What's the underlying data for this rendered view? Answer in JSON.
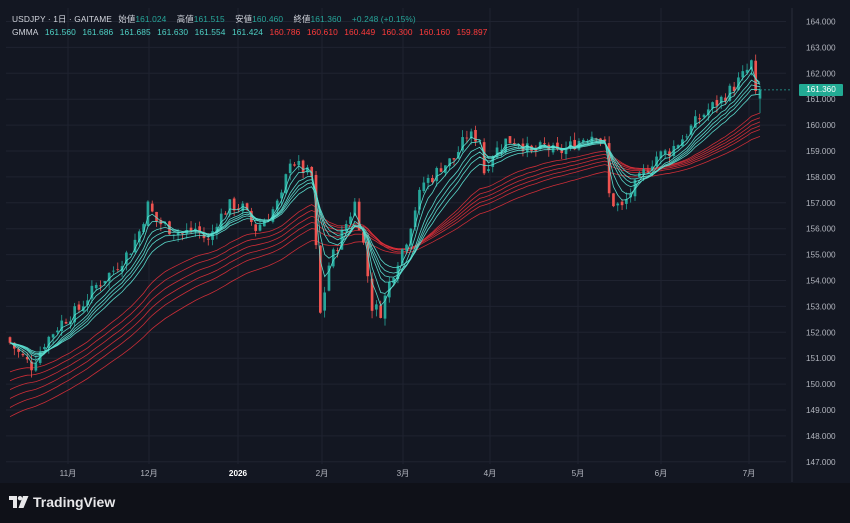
{
  "legend": {
    "symbol": "USDJPY · 1日 · GAITAME",
    "open_label": "始値",
    "open": "161.024",
    "high_label": "高値",
    "high": "161.515",
    "low_label": "安値",
    "low": "160.460",
    "close_label": "終値",
    "close": "161.360",
    "change": "+0.248 (+0.15%)",
    "gmma_label": "GMMA",
    "short_values": [
      "161.560",
      "161.686",
      "161.685",
      "161.630",
      "161.554",
      "161.424"
    ],
    "long_values": [
      "160.786",
      "160.610",
      "160.449",
      "160.300",
      "160.160",
      "159.897"
    ]
  },
  "price_tag": "161.360",
  "brand": "TradingView",
  "colors": {
    "background": "#131722",
    "up": "#26a69a",
    "down": "#ef5350",
    "short_ma": "#5ce0d2",
    "long_ma": "#e0303a",
    "grid": "#1f2330",
    "axis_text": "#b2b5be"
  },
  "chart_data": {
    "type": "candlestick",
    "y_axis": {
      "min": 146.5,
      "max": 164.5,
      "ticks": [
        "164.000",
        "163.000",
        "162.000",
        "161.000",
        "160.000",
        "159.000",
        "158.000",
        "157.000",
        "156.000",
        "155.000",
        "154.000",
        "153.000",
        "152.000",
        "151.000",
        "150.000",
        "149.000",
        "148.000",
        "147.000"
      ]
    },
    "x_axis": {
      "ticks": [
        "11月",
        "12月",
        "2026",
        "2月",
        "3月",
        "4月",
        "5月",
        "6月",
        "7月"
      ]
    },
    "last_price": 161.36,
    "series": [
      {
        "name": "USDJPY",
        "close_path": [
          {
            "t": 0,
            "v": 151.6
          },
          {
            "t": 2,
            "v": 151.2
          },
          {
            "t": 5,
            "v": 150.7
          },
          {
            "t": 8,
            "v": 151.6
          },
          {
            "t": 12,
            "v": 152.4
          },
          {
            "t": 16,
            "v": 152.9
          },
          {
            "t": 20,
            "v": 153.8
          },
          {
            "t": 24,
            "v": 154.4
          },
          {
            "t": 28,
            "v": 155.2
          },
          {
            "t": 30,
            "v": 155.9
          },
          {
            "t": 32,
            "v": 156.9
          },
          {
            "t": 34,
            "v": 156.3
          },
          {
            "t": 37,
            "v": 156.0
          },
          {
            "t": 40,
            "v": 155.8
          },
          {
            "t": 43,
            "v": 156.0
          },
          {
            "t": 46,
            "v": 155.5
          },
          {
            "t": 48,
            "v": 156.3
          },
          {
            "t": 51,
            "v": 156.9
          },
          {
            "t": 54,
            "v": 156.8
          },
          {
            "t": 57,
            "v": 156.0
          },
          {
            "t": 60,
            "v": 156.5
          },
          {
            "t": 63,
            "v": 157.2
          },
          {
            "t": 65,
            "v": 158.7
          },
          {
            "t": 67,
            "v": 158.4
          },
          {
            "t": 70,
            "v": 158.0
          },
          {
            "t": 71,
            "v": 155.2
          },
          {
            "t": 72,
            "v": 152.7
          },
          {
            "t": 73,
            "v": 153.6
          },
          {
            "t": 74,
            "v": 154.6
          },
          {
            "t": 77,
            "v": 155.8
          },
          {
            "t": 80,
            "v": 157.0
          },
          {
            "t": 82,
            "v": 155.4
          },
          {
            "t": 84,
            "v": 153.0
          },
          {
            "t": 86,
            "v": 152.8
          },
          {
            "t": 88,
            "v": 153.9
          },
          {
            "t": 90,
            "v": 154.8
          },
          {
            "t": 92,
            "v": 155.6
          },
          {
            "t": 94,
            "v": 156.8
          },
          {
            "t": 96,
            "v": 157.8
          },
          {
            "t": 98,
            "v": 158.0
          },
          {
            "t": 100,
            "v": 158.4
          },
          {
            "t": 103,
            "v": 158.7
          },
          {
            "t": 106,
            "v": 159.6
          },
          {
            "t": 109,
            "v": 159.5
          },
          {
            "t": 110,
            "v": 158.2
          },
          {
            "t": 112,
            "v": 158.9
          },
          {
            "t": 115,
            "v": 159.4
          },
          {
            "t": 118,
            "v": 159.4
          },
          {
            "t": 121,
            "v": 158.9
          },
          {
            "t": 124,
            "v": 159.2
          },
          {
            "t": 127,
            "v": 158.9
          },
          {
            "t": 130,
            "v": 159.2
          },
          {
            "t": 133,
            "v": 159.5
          },
          {
            "t": 136,
            "v": 159.7
          },
          {
            "t": 138,
            "v": 159.2
          },
          {
            "t": 139,
            "v": 157.3
          },
          {
            "t": 140,
            "v": 157.0
          },
          {
            "t": 142,
            "v": 156.8
          },
          {
            "t": 144,
            "v": 157.4
          },
          {
            "t": 146,
            "v": 157.9
          },
          {
            "t": 148,
            "v": 158.4
          },
          {
            "t": 150,
            "v": 158.8
          },
          {
            "t": 153,
            "v": 159.0
          },
          {
            "t": 156,
            "v": 159.5
          },
          {
            "t": 159,
            "v": 160.1
          },
          {
            "t": 162,
            "v": 160.6
          },
          {
            "t": 165,
            "v": 161.0
          },
          {
            "t": 168,
            "v": 161.5
          },
          {
            "t": 170,
            "v": 161.9
          },
          {
            "t": 171,
            "v": 162.1
          },
          {
            "t": 172,
            "v": 162.4
          },
          {
            "t": 173,
            "v": 161.1
          },
          {
            "t": 174,
            "v": 161.36
          }
        ],
        "volatility": 0.32
      }
    ],
    "gmma_short_periods": [
      3,
      5,
      8,
      10,
      12,
      15
    ],
    "gmma_long_periods": [
      30,
      35,
      40,
      45,
      50,
      60
    ],
    "gmma_long_warmup": 18
  }
}
